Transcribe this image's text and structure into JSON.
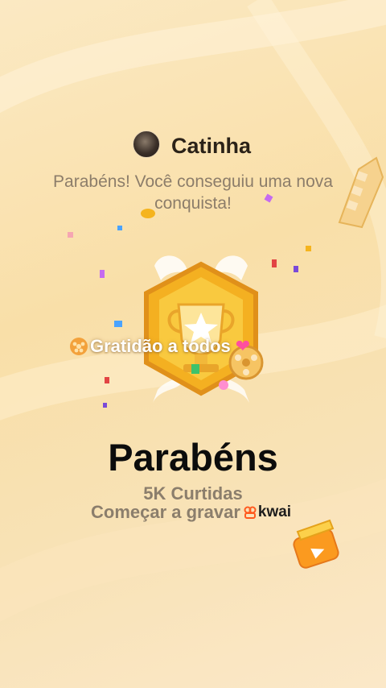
{
  "header": {
    "username": "Catinha"
  },
  "subtitle": "Parabéns! Você conseguiu uma nova conquista!",
  "badge": {
    "caption": "Gratidão a todos"
  },
  "main": {
    "title": "Parabéns",
    "likes": "5K Curtidas",
    "record_label": "Começar a gravar",
    "brand": "kwai"
  },
  "colors": {
    "accent": "#f5b41e",
    "brand": "#ff5a1f",
    "title": "#0c0c0c",
    "muted": "#8b7e6c"
  },
  "icons": [
    "avatar",
    "film-reel-icon",
    "trophy-badge-icon",
    "heart-icon",
    "kwai-logo-icon",
    "clapperboard-icon"
  ]
}
